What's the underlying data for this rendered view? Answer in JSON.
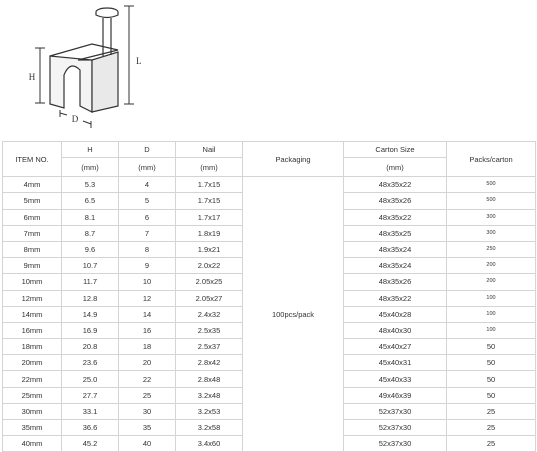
{
  "diagram": {
    "h_label": "H",
    "d_label": "D",
    "l_label": "L"
  },
  "table": {
    "headers": {
      "item": "ITEM NO.",
      "h": "H",
      "d": "D",
      "nail": "Nail",
      "packaging": "Packaging",
      "carton": "Carton Size",
      "packs": "Packs/carton"
    },
    "units": {
      "h": "(mm)",
      "d": "(mm)",
      "nail": "(mm)",
      "carton": "(mm)"
    },
    "packaging": "100pcs/pack",
    "rows": [
      {
        "item": "4mm",
        "h": "5.3",
        "d": "4",
        "nail": "1.7x15",
        "carton": "48x35x22",
        "packs": "500"
      },
      {
        "item": "5mm",
        "h": "6.5",
        "d": "5",
        "nail": "1.7x15",
        "carton": "48x35x26",
        "packs": "500"
      },
      {
        "item": "6mm",
        "h": "8.1",
        "d": "6",
        "nail": "1.7x17",
        "carton": "48x35x22",
        "packs": "300"
      },
      {
        "item": "7mm",
        "h": "8.7",
        "d": "7",
        "nail": "1.8x19",
        "carton": "48x35x25",
        "packs": "300"
      },
      {
        "item": "8mm",
        "h": "9.6",
        "d": "8",
        "nail": "1.9x21",
        "carton": "48x35x24",
        "packs": "250"
      },
      {
        "item": "9mm",
        "h": "10.7",
        "d": "9",
        "nail": "2.0x22",
        "carton": "48x35x24",
        "packs": "200"
      },
      {
        "item": "10mm",
        "h": "11.7",
        "d": "10",
        "nail": "2.05x25",
        "carton": "48x35x26",
        "packs": "200"
      },
      {
        "item": "12mm",
        "h": "12.8",
        "d": "12",
        "nail": "2.05x27",
        "carton": "48x35x22",
        "packs": "100"
      },
      {
        "item": "14mm",
        "h": "14.9",
        "d": "14",
        "nail": "2.4x32",
        "carton": "45x40x28",
        "packs": "100"
      },
      {
        "item": "16mm",
        "h": "16.9",
        "d": "16",
        "nail": "2.5x35",
        "carton": "48x40x30",
        "packs": "100"
      },
      {
        "item": "18mm",
        "h": "20.8",
        "d": "18",
        "nail": "2.5x37",
        "carton": "45x40x27",
        "packs": "50"
      },
      {
        "item": "20mm",
        "h": "23.6",
        "d": "20",
        "nail": "2.8x42",
        "carton": "45x40x31",
        "packs": "50"
      },
      {
        "item": "22mm",
        "h": "25.0",
        "d": "22",
        "nail": "2.8x48",
        "carton": "45x40x33",
        "packs": "50"
      },
      {
        "item": "25mm",
        "h": "27.7",
        "d": "25",
        "nail": "3.2x48",
        "carton": "49x46x39",
        "packs": "50"
      },
      {
        "item": "30mm",
        "h": "33.1",
        "d": "30",
        "nail": "3.2x53",
        "carton": "52x37x30",
        "packs": "25"
      },
      {
        "item": "35mm",
        "h": "36.6",
        "d": "35",
        "nail": "3.2x58",
        "carton": "52x37x30",
        "packs": "25"
      },
      {
        "item": "40mm",
        "h": "45.2",
        "d": "40",
        "nail": "3.4x60",
        "carton": "52x37x30",
        "packs": "25"
      }
    ]
  }
}
